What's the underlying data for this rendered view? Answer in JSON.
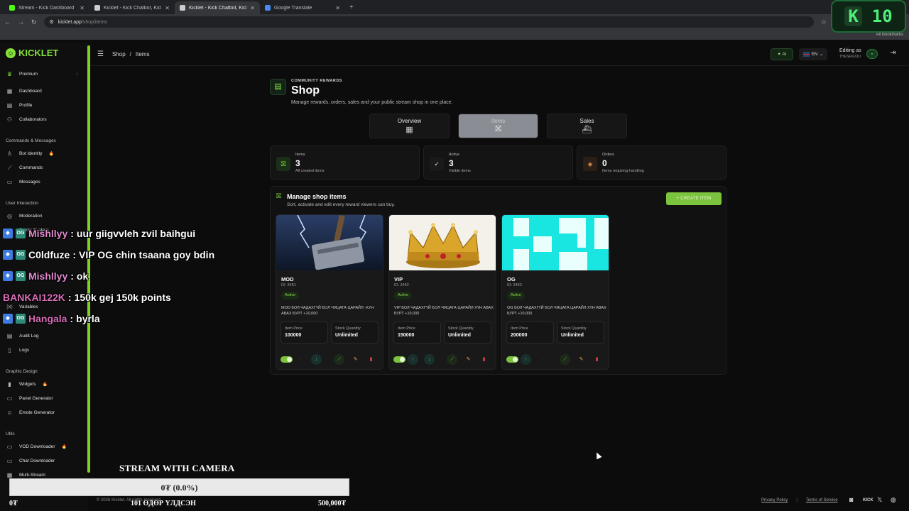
{
  "browser": {
    "tabs": [
      {
        "title": "Stream - Kick Dashboard",
        "color": "#53fc18"
      },
      {
        "title": "Kicklet - Kick Chatbot, Kick Wi",
        "color": "#cccccc"
      },
      {
        "title": "Kicklet - Kick Chatbot, Kick Wi",
        "color": "#cccccc"
      },
      {
        "title": "Google Translate",
        "color": "#4a8af4"
      }
    ],
    "url_host": "kicklet.app",
    "url_path": "/shop/items",
    "bookmarks": "All Bookmarks"
  },
  "overlay_badge": {
    "k": "K",
    "num": "10"
  },
  "sidebar": {
    "logo": "KICKLET",
    "premium": "Premium",
    "items_main": [
      {
        "label": "Dashboard",
        "icon": "dashboard-icon",
        "glyph": "▦"
      },
      {
        "label": "Profile",
        "icon": "profile-icon",
        "glyph": "▤"
      },
      {
        "label": "Collaborators",
        "icon": "collaborators-icon",
        "glyph": "⚇"
      }
    ],
    "sec_commands": "Commands & Messages",
    "items_commands": [
      {
        "label": "Bot Identity",
        "icon": "bot-icon",
        "glyph": "♙",
        "fire": true
      },
      {
        "label": "Commands",
        "icon": "wand-icon",
        "glyph": "⟋"
      },
      {
        "label": "Messages",
        "icon": "message-icon",
        "glyph": "▭"
      }
    ],
    "sec_interaction": "User Interaction",
    "items_interaction": [
      {
        "label": "Moderation",
        "icon": "shield-icon",
        "glyph": "◎"
      },
      {
        "label": "Points System",
        "icon": "sparkle-icon",
        "glyph": "✦"
      },
      {
        "label": "Variables",
        "icon": "variables-icon",
        "glyph": "⒳"
      },
      {
        "label": "Audit Log",
        "icon": "audit-log-icon",
        "glyph": "▤"
      },
      {
        "label": "Logs",
        "icon": "logs-icon",
        "glyph": "▯"
      }
    ],
    "sec_graphic": "Graphic Design",
    "items_graphic": [
      {
        "label": "Widgets",
        "icon": "widgets-icon",
        "glyph": "▮",
        "fire": true
      },
      {
        "label": "Panel Generator",
        "icon": "panel-icon",
        "glyph": "▭"
      },
      {
        "label": "Emote Generator",
        "icon": "emote-icon",
        "glyph": "☺"
      }
    ],
    "sec_utils": "Utils",
    "items_utils": [
      {
        "label": "VOD Downloader",
        "icon": "vod-icon",
        "glyph": "▭",
        "fire": true
      },
      {
        "label": "Chat Downloader",
        "icon": "chat-download-icon",
        "glyph": "▭"
      },
      {
        "label": "Multi-Stream",
        "icon": "multistream-icon",
        "glyph": "▦"
      }
    ]
  },
  "topbar": {
    "crumb1": "Shop",
    "sep": "/",
    "crumb2": "Items",
    "ai": "AI",
    "lang": "EN",
    "editing": "Editing as",
    "username": "THESENJUU"
  },
  "shop": {
    "eyebrow": "COMMUNITY REWARDS",
    "title": "Shop",
    "desc": "Manage rewards, orders, sales and your public stream shop in one place.",
    "tabs": [
      "Overview",
      "Items",
      "Sales"
    ]
  },
  "stats": [
    {
      "label": "Items",
      "value": "3",
      "desc": "All created items"
    },
    {
      "label": "Active",
      "value": "3",
      "desc": "Visible items"
    },
    {
      "label": "Orders",
      "value": "0",
      "desc": "Items requiring handling"
    }
  ],
  "panel": {
    "title": "Manage shop items",
    "desc": "Sort, activate and edit every reward viewers can buy.",
    "create": "+ CREATE ITEM"
  },
  "items": [
    {
      "name": "MOD",
      "id": "ID: 3481",
      "status": "Active",
      "desc": "MOD БОЛ ЧАДАХГҮЙ БОЛ ЧЯЦАГА ЦАРАЙЛ -ХУН АВАХ БУРТ +10,000",
      "price_label": "Item Price",
      "price": "100000",
      "stock_label": "Stock Quantity",
      "stock": "Unlimited"
    },
    {
      "name": "VIP",
      "id": "ID: 3482",
      "status": "Active",
      "desc": "VIP БОЛ ЧАДАХГҮЙ БОЛ ЧЯЦАГА ЦАРАЙЛ ХҮН АВАХ БУРТ +10,000",
      "price_label": "Item Price",
      "price": "150000",
      "stock_label": "Stock Quantity",
      "stock": "Unlimited"
    },
    {
      "name": "OG",
      "id": "ID: 3483",
      "status": "Active",
      "desc": "OG БОЛ ЧАДАХГҮЙ БОЛ ЧЯЦАГА ЦАРАЙЛ ХҮН АВАХ БУРТ +10,000",
      "price_label": "Item Price",
      "price": "200000",
      "stock_label": "Stock Quantity",
      "stock": "Unlimited"
    }
  ],
  "chat": [
    {
      "user": "Mishllyy",
      "sep": " : ",
      "msg": "uur giigvvleh zvil baihgui"
    },
    {
      "user": "C0ldfuze",
      "sep": " : ",
      "msg": "VIP OG chin tsaana goy bdin"
    },
    {
      "user": "Mishllyy",
      "sep": " : ",
      "msg": "ok"
    },
    {
      "user": "BANKAI122K",
      "sep": " : ",
      "msg": "150k gej 150k points"
    },
    {
      "user": "Hangala",
      "sep": " : ",
      "msg": "byrla"
    }
  ],
  "donation": {
    "title": "STREAM WITH CAMERA",
    "progress": "0₮ (0.0%)",
    "left": "0₮",
    "mid": "101 ӨДӨР ҮЛДСЭН",
    "right": "500,000₮"
  },
  "footer": {
    "copyright": "© 2026 Kicklet. All rights reserved.",
    "privacy": "Privacy Policy",
    "divider": "|",
    "terms": "Terms of Service"
  }
}
